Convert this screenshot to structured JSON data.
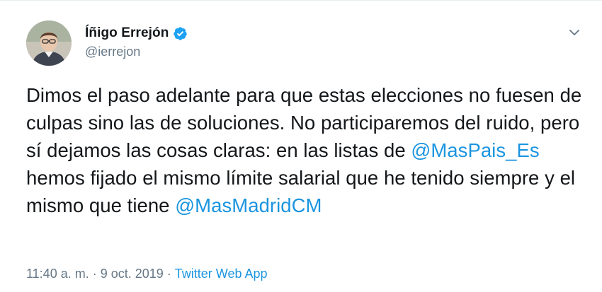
{
  "author": {
    "display_name": "Íñigo Errejón",
    "handle": "@ierrejon",
    "verified": true,
    "avatar": "profile-photo"
  },
  "tweet": {
    "segments": [
      {
        "type": "text",
        "value": "Dimos el paso adelante para que estas elecciones no fuesen de culpas sino las de soluciones. No participaremos del ruido, pero sí dejamos las cosas claras: en las listas de "
      },
      {
        "type": "mention",
        "value": "@MasPais_Es"
      },
      {
        "type": "text",
        "value": " hemos fijado el mismo límite salarial que he tenido siempre y el mismo que tiene "
      },
      {
        "type": "mention",
        "value": "@MasMadridCM"
      }
    ]
  },
  "meta": {
    "time": "11:40 a. m.",
    "separator1": "·",
    "date": "9 oct. 2019",
    "separator2": "·",
    "source": "Twitter Web App"
  },
  "icons": {
    "verified": "verified-badge-icon",
    "menu": "chevron-down-icon"
  },
  "colors": {
    "link": "#1b95e0",
    "secondary_text": "#657786",
    "primary_text": "#14171a",
    "verified_badge": "#1da1f2"
  }
}
